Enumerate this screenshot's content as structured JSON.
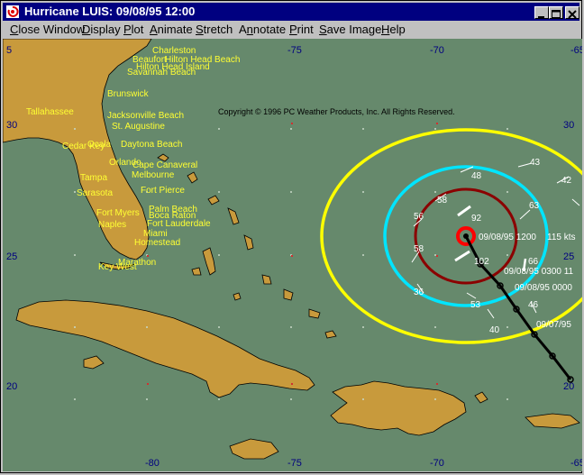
{
  "window": {
    "title": "Hurricane LUIS: 09/08/95 12:00"
  },
  "menu": [
    {
      "label": "Close Window",
      "accel": "C"
    },
    {
      "label": "Display",
      "accel": "D"
    },
    {
      "label": "Plot",
      "accel": "P"
    },
    {
      "label": "Animate",
      "accel": "A"
    },
    {
      "label": "Stretch",
      "accel": "S"
    },
    {
      "label": "Annotate",
      "accel": "n"
    },
    {
      "label": "Print",
      "accel": "P"
    },
    {
      "label": "Save Image",
      "accel": "S"
    },
    {
      "label": "Help",
      "accel": "H"
    }
  ],
  "map": {
    "copyright": "Copyright © 1996 PC Weather Products, Inc. All Rights Reserved.",
    "longitude_labels": [
      "-80",
      "-75",
      "-70",
      "-65",
      "5"
    ],
    "latitude_labels": [
      "30",
      "25",
      "20"
    ],
    "cities": [
      "Charleston",
      "Beaufort",
      "Hilton Head Beach",
      "Hilton Head Island",
      "Savannah Beach",
      "Brunswick",
      "Tallahassee",
      "Jacksonville Beach",
      "St. Augustine",
      "Ocala",
      "Daytona Beach",
      "Cedar Key",
      "Orlando",
      "Cape Canaveral",
      "Melbourne",
      "Tampa",
      "Fort Pierce",
      "Sarasota",
      "Palm Beach",
      "Boca Raton",
      "Fort Lauderdale",
      "Fort Myers",
      "Naples",
      "Miami",
      "Homestead",
      "Marathon",
      "Key West"
    ],
    "storm": {
      "name": "LUIS",
      "track_labels": [
        "09/08/95 1200",
        "115  kts",
        "09/08/95 0300  11",
        "09/08/95 0000",
        "09/07/95"
      ],
      "wind_values": [
        "43",
        "42",
        "48",
        "58",
        "63",
        "56",
        "92",
        "58",
        "102",
        "66",
        "36",
        "53",
        "46",
        "40"
      ],
      "ring_colors": [
        "#ffff00",
        "#00e5ff",
        "#8b0000",
        "#ff0000"
      ]
    }
  }
}
